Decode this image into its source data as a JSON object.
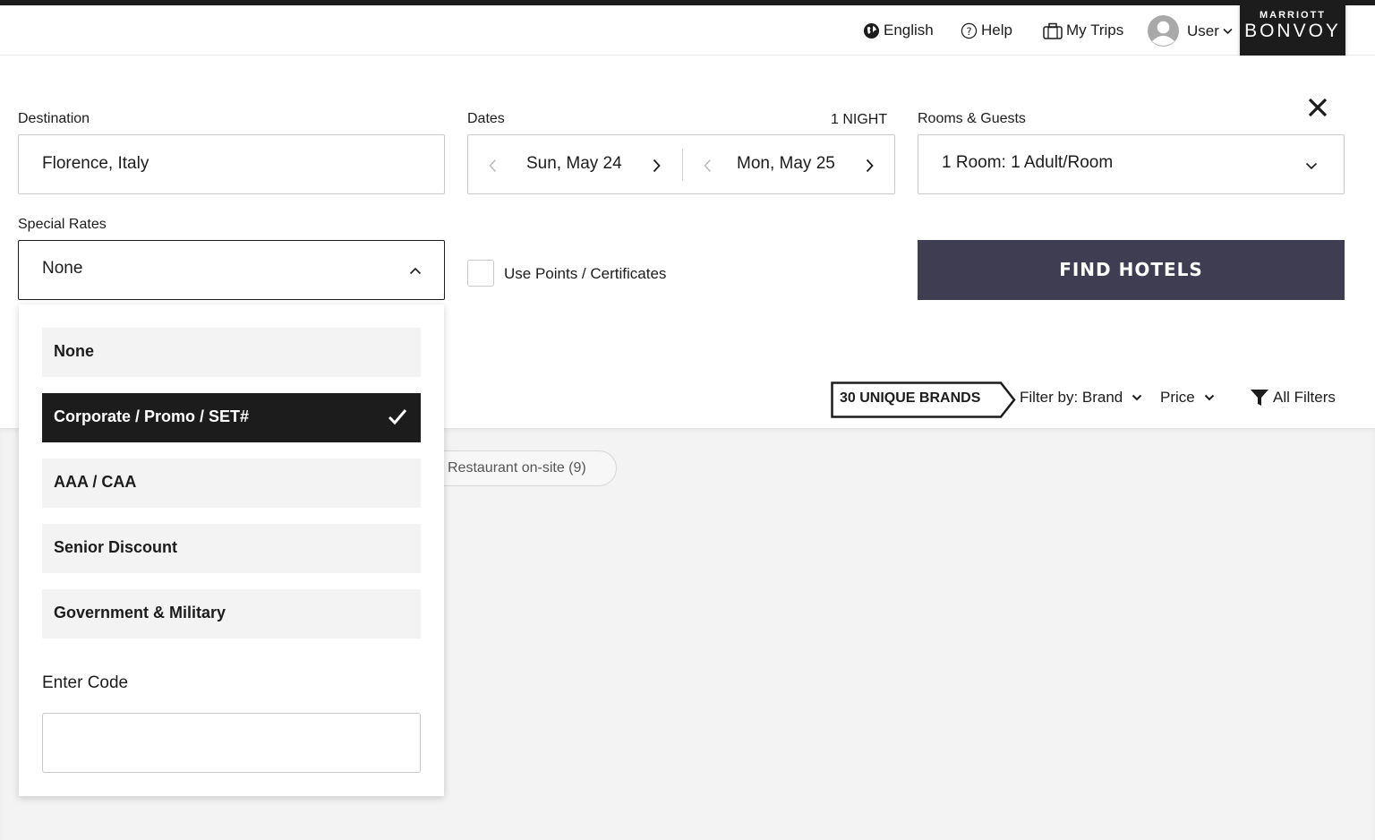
{
  "header": {
    "language": "English",
    "help": "Help",
    "my_trips": "My Trips",
    "user": "User",
    "logo_top": "MARRIOTT",
    "logo_main": "BONVOY"
  },
  "search": {
    "destination_label": "Destination",
    "destination_value": "Florence, Italy",
    "dates_label": "Dates",
    "nights": "1 NIGHT",
    "check_in": "Sun, May 24",
    "check_out": "Mon, May 25",
    "rooms_label": "Rooms & Guests",
    "rooms_value": "1 Room: 1 Adult/Room",
    "special_rates_label": "Special Rates",
    "special_rates_value": "None",
    "use_points_label": "Use Points / Certificates",
    "find_button": "FIND HOTELS"
  },
  "dropdown": {
    "options": [
      {
        "label": "None",
        "selected": false
      },
      {
        "label": "Corporate / Promo / SET#",
        "selected": true
      },
      {
        "label": "AAA / CAA",
        "selected": false
      },
      {
        "label": "Senior Discount",
        "selected": false
      },
      {
        "label": "Government & Military",
        "selected": false
      }
    ],
    "enter_code_label": "Enter Code",
    "code_value": ""
  },
  "filters": {
    "brands_badge": "30 UNIQUE BRANDS",
    "filter_brand": "Filter by: Brand",
    "price": "Price",
    "all_filters": "All Filters",
    "pill": "Restaurant on-site (9)"
  },
  "colors": {
    "primary_button": "#3f3d52",
    "dark": "#1c1c1c",
    "page_gray": "#f3f3f3"
  },
  "icons": [
    "globe-icon",
    "help-icon",
    "briefcase-icon",
    "avatar-icon",
    "close-icon",
    "chevron-left-icon",
    "chevron-right-icon",
    "chevron-down-icon",
    "chevron-up-icon",
    "checkmark-icon",
    "funnel-icon"
  ]
}
